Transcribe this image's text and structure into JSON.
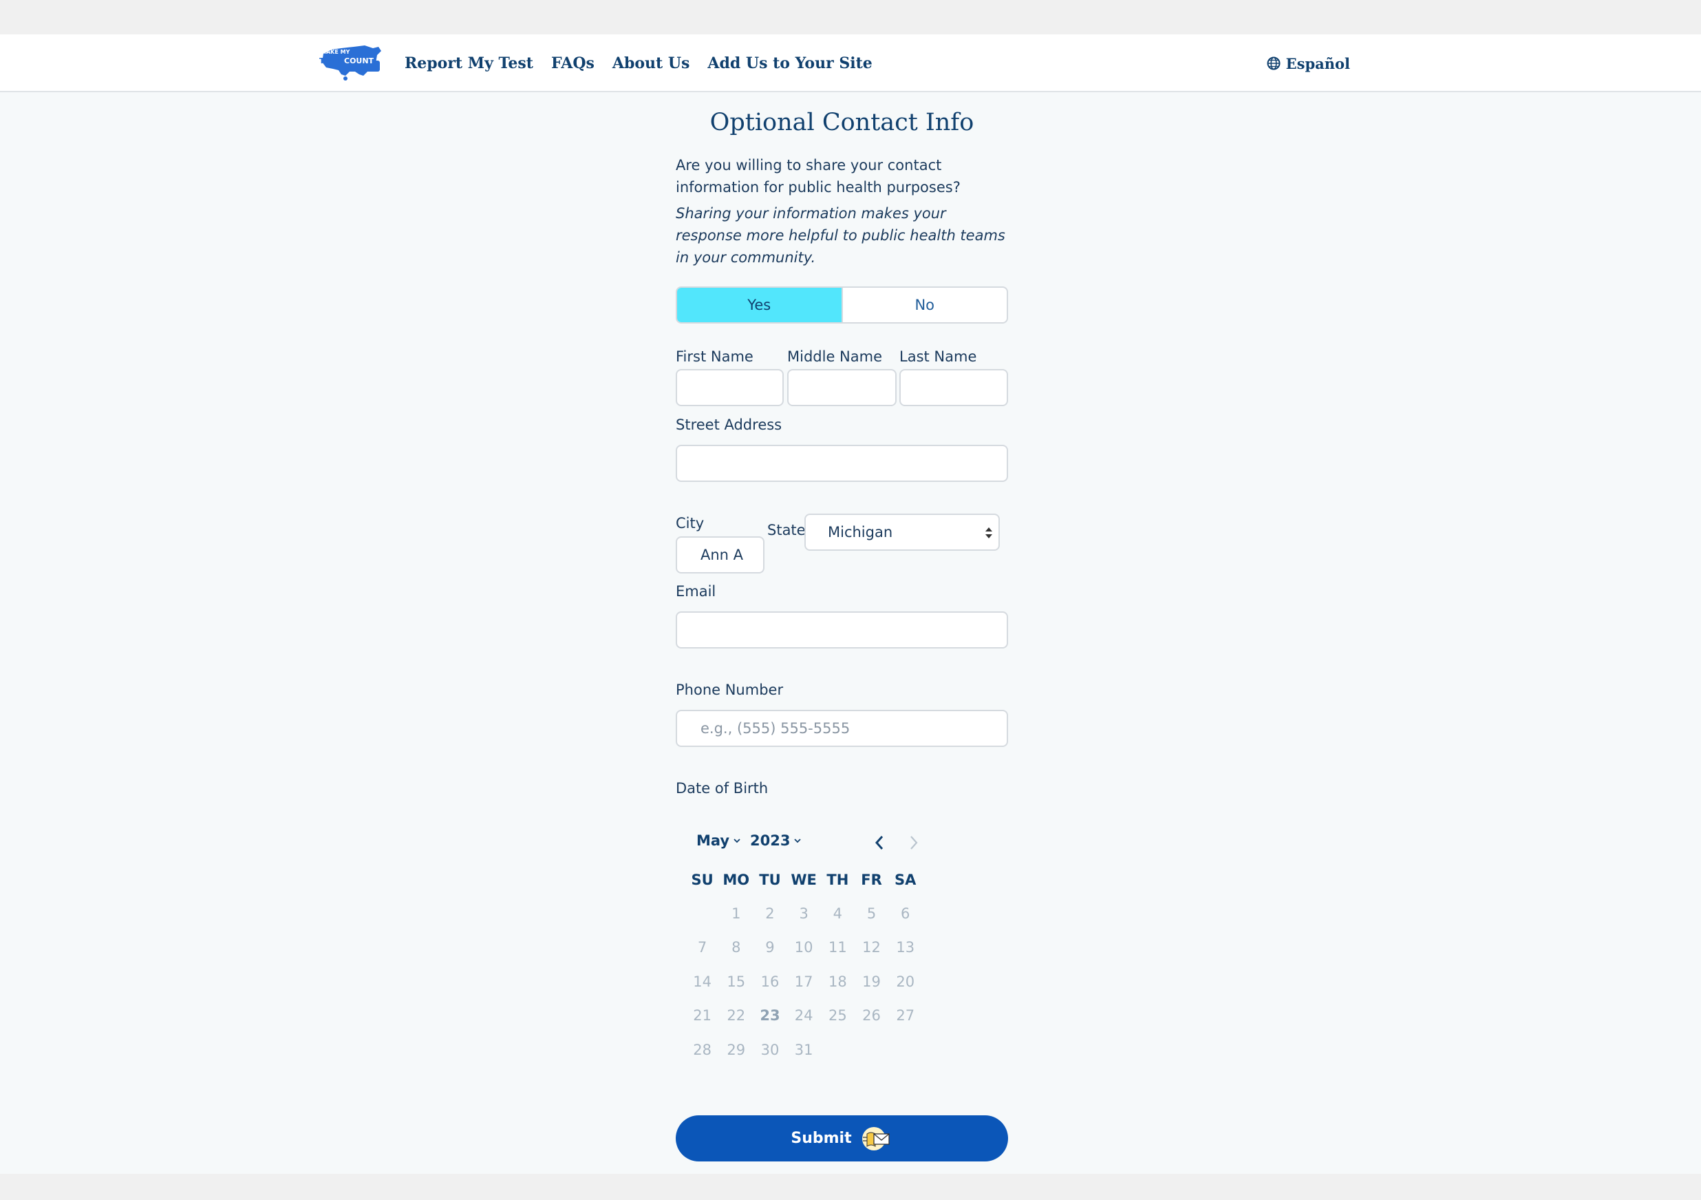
{
  "header": {
    "logo_text_top": "MAKE MY",
    "logo_text_bottom_left": "TEST",
    "logo_text_bottom_right": "COUNT",
    "nav": [
      "Report My Test",
      "FAQs",
      "About Us",
      "Add Us to Your Site"
    ],
    "language_label": "Español",
    "language_icon": "globe-icon"
  },
  "form": {
    "title": "Optional Contact Info",
    "question": "Are you willing to share your contact information for public health purposes?",
    "hint": "Sharing your information makes your response more helpful to public health teams in your community.",
    "share_options": [
      "Yes",
      "No"
    ],
    "share_selected": "Yes",
    "first_name": {
      "label": "First Name",
      "value": ""
    },
    "middle_name": {
      "label": "Middle Name",
      "value": ""
    },
    "last_name": {
      "label": "Last Name",
      "value": ""
    },
    "street_address": {
      "label": "Street Address",
      "value": ""
    },
    "city": {
      "label": "City",
      "value": "Ann A"
    },
    "state": {
      "label": "State",
      "value": "Michigan"
    },
    "email": {
      "label": "Email",
      "value": ""
    },
    "phone": {
      "label": "Phone Number",
      "placeholder": "e.g., (555) 555-5555",
      "value": ""
    },
    "dob": {
      "label": "Date of Birth",
      "month": "May",
      "year": "2023",
      "weekdays": [
        "SU",
        "MO",
        "TU",
        "WE",
        "TH",
        "FR",
        "SA"
      ],
      "weeks": [
        [
          "",
          "1",
          "2",
          "3",
          "4",
          "5",
          "6"
        ],
        [
          "7",
          "8",
          "9",
          "10",
          "11",
          "12",
          "13"
        ],
        [
          "14",
          "15",
          "16",
          "17",
          "18",
          "19",
          "20"
        ],
        [
          "21",
          "22",
          "23",
          "24",
          "25",
          "26",
          "27"
        ],
        [
          "28",
          "29",
          "30",
          "31",
          "",
          "",
          ""
        ]
      ],
      "highlighted_day": "23"
    },
    "submit_label": "Submit"
  },
  "colors": {
    "brand_navy": "#10406e",
    "selected_toggle": "#52e6fc",
    "submit_blue": "#0b56b8"
  }
}
